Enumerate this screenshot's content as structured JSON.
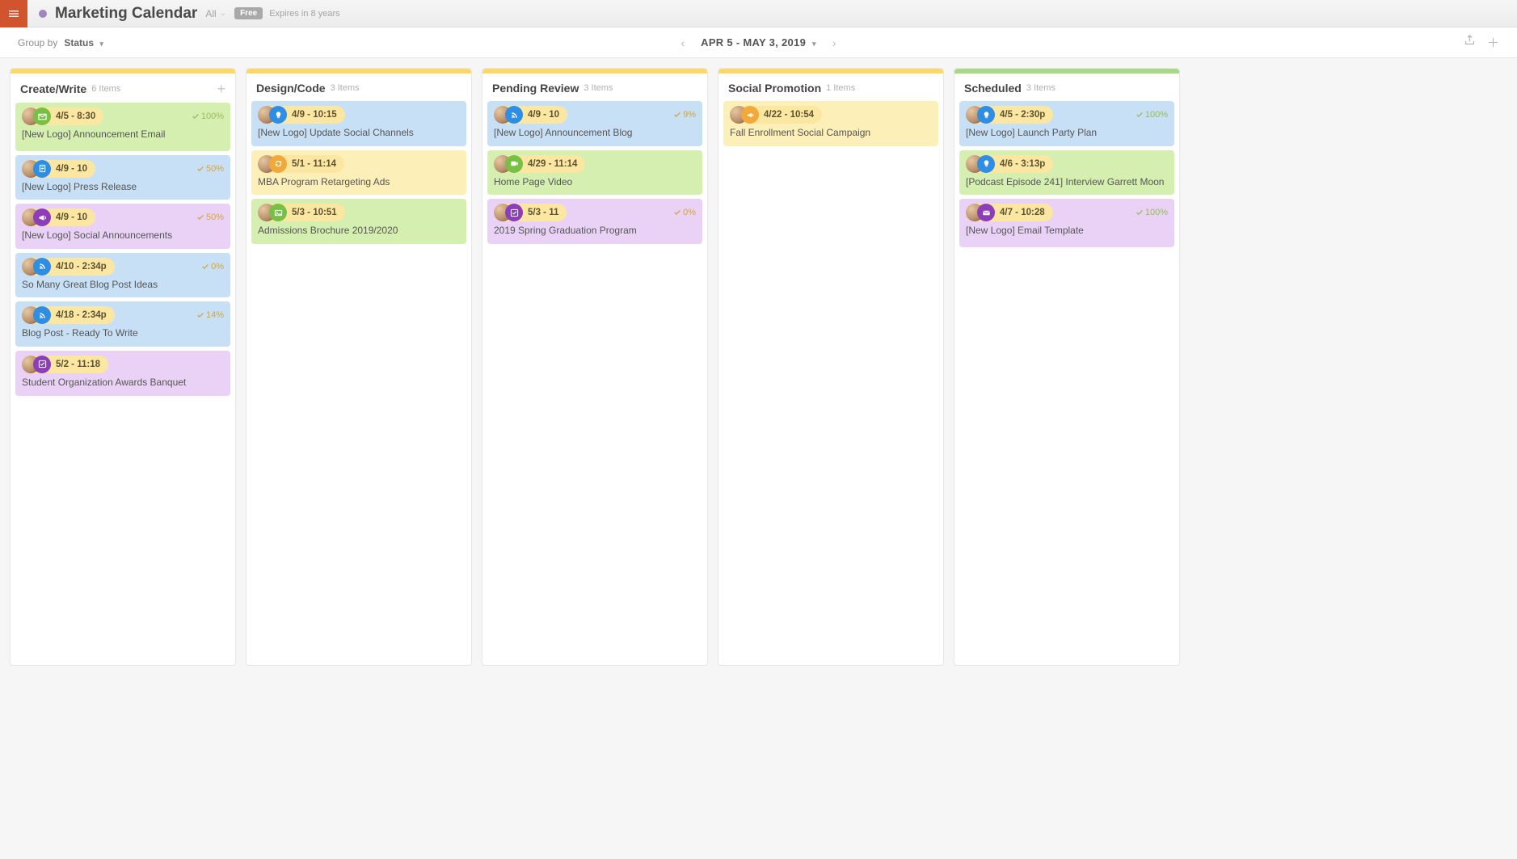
{
  "header": {
    "title": "Marketing Calendar",
    "sub": "All",
    "free_badge": "Free",
    "expires": "Expires in 8 years"
  },
  "filter": {
    "groupby_label": "Group by",
    "groupby_value": "Status",
    "date_range": "APR 5 - MAY 3, 2019"
  },
  "icon_colors": {
    "email": "ib-green",
    "doc": "ib-blue",
    "bulb": "ib-blue",
    "rss": "ib-blue",
    "megaphone": "ib-purple",
    "refresh": "ib-amber",
    "image": "ib-green",
    "video": "ib-green",
    "check": "ib-purple",
    "announce": "ib-amber",
    "mail": "ib-purple"
  },
  "columns": [
    {
      "name": "Create/Write",
      "count": "6 Items",
      "stripe": "stripe-yellow",
      "show_add": true,
      "cards": [
        {
          "bg": "bg-green",
          "icon": "email",
          "date": "4/5 - 8:30",
          "progress": "100%",
          "pclass": "",
          "title": "[New Logo] Announcement Email",
          "tall": true
        },
        {
          "bg": "bg-blue",
          "icon": "doc",
          "date": "4/9 - 10",
          "progress": "50%",
          "pclass": "mid",
          "title": "[New Logo] Press Release"
        },
        {
          "bg": "bg-purple",
          "icon": "megaphone",
          "date": "4/9 - 10",
          "progress": "50%",
          "pclass": "mid",
          "title": "[New Logo] Social Announcements"
        },
        {
          "bg": "bg-blue",
          "icon": "rss",
          "date": "4/10 - 2:34p",
          "progress": "0%",
          "pclass": "low",
          "title": "So Many Great Blog Post Ideas"
        },
        {
          "bg": "bg-blue",
          "icon": "rss",
          "date": "4/18 - 2:34p",
          "progress": "14%",
          "pclass": "low",
          "title": "Blog Post - Ready To Write"
        },
        {
          "bg": "bg-purple",
          "icon": "check",
          "date": "5/2 - 11:18",
          "progress": "",
          "pclass": "",
          "title": "Student Organization Awards Banquet"
        }
      ]
    },
    {
      "name": "Design/Code",
      "count": "3 Items",
      "stripe": "stripe-yellow",
      "show_add": false,
      "cards": [
        {
          "bg": "bg-blue",
          "icon": "bulb",
          "date": "4/9 - 10:15",
          "progress": "",
          "pclass": "",
          "title": "[New Logo] Update Social Channels"
        },
        {
          "bg": "bg-yellow",
          "icon": "refresh",
          "date": "5/1 - 11:14",
          "progress": "",
          "pclass": "",
          "title": "MBA Program Retargeting Ads"
        },
        {
          "bg": "bg-green",
          "icon": "image",
          "date": "5/3 - 10:51",
          "progress": "",
          "pclass": "",
          "title": "Admissions Brochure 2019/2020"
        }
      ]
    },
    {
      "name": "Pending Review",
      "count": "3 Items",
      "stripe": "stripe-yellow",
      "show_add": false,
      "cards": [
        {
          "bg": "bg-blue",
          "icon": "rss",
          "date": "4/9 - 10",
          "progress": "9%",
          "pclass": "low",
          "title": "[New Logo] Announcement Blog"
        },
        {
          "bg": "bg-green",
          "icon": "video",
          "date": "4/29 - 11:14",
          "progress": "",
          "pclass": "",
          "title": "Home Page Video"
        },
        {
          "bg": "bg-purple",
          "icon": "check",
          "date": "5/3 - 11",
          "progress": "0%",
          "pclass": "low",
          "title": "2019 Spring Graduation Program"
        }
      ]
    },
    {
      "name": "Social Promotion",
      "count": "1 Items",
      "stripe": "stripe-yellow",
      "show_add": false,
      "cards": [
        {
          "bg": "bg-yellow",
          "icon": "announce",
          "date": "4/22 - 10:54",
          "progress": "",
          "pclass": "",
          "title": "Fall Enrollment Social Campaign"
        }
      ]
    },
    {
      "name": "Scheduled",
      "count": "3 Items",
      "stripe": "stripe-green",
      "show_add": false,
      "cards": [
        {
          "bg": "bg-blue",
          "icon": "bulb",
          "date": "4/5 - 2:30p",
          "progress": "100%",
          "pclass": "",
          "title": "[New Logo] Launch Party Plan"
        },
        {
          "bg": "bg-green",
          "icon": "bulb",
          "date": "4/6 - 3:13p",
          "progress": "",
          "pclass": "",
          "title": "[Podcast Episode 241] Interview Garrett Moon"
        },
        {
          "bg": "bg-purple",
          "icon": "mail",
          "date": "4/7 - 10:28",
          "progress": "100%",
          "pclass": "",
          "title": "[New Logo] Email Template",
          "tall": true
        }
      ]
    }
  ]
}
